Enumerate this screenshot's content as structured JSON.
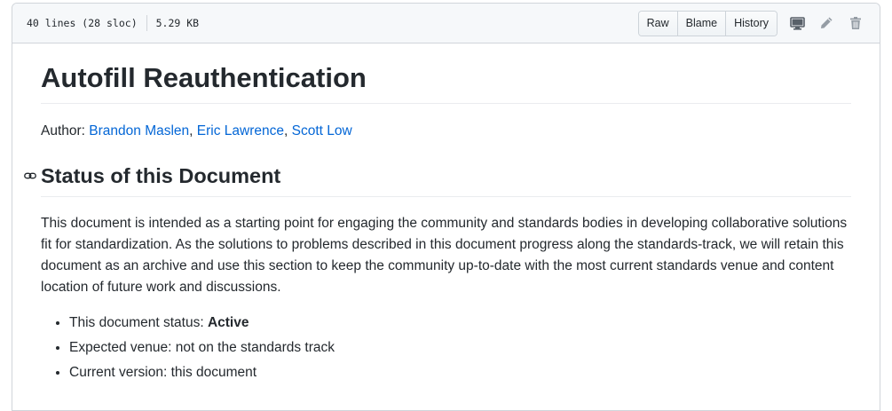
{
  "file_header": {
    "lines": "40 lines (28 sloc)",
    "size": "5.29 KB",
    "buttons": {
      "raw": "Raw",
      "blame": "Blame",
      "history": "History"
    },
    "icons": [
      "desktop-icon",
      "pencil-icon",
      "trash-icon"
    ]
  },
  "document": {
    "title": "Autofill Reauthentication",
    "author_label": "Author: ",
    "authors": [
      "Brandon Maslen",
      "Eric Lawrence",
      "Scott Low"
    ],
    "separator": ", ",
    "status_heading": "Status of this Document",
    "status_paragraph": "This document is intended as a starting point for engaging the community and standards bodies in developing collaborative solutions fit for standardization. As the solutions to problems described in this document progress along the standards-track, we will retain this document as an archive and use this section to keep the community up-to-date with the most current standards venue and content location of future work and discussions.",
    "status_items": [
      {
        "label": "This document status: ",
        "value": "Active"
      },
      {
        "label": "Expected venue: not on the standards track"
      },
      {
        "label": "Current version: this document"
      }
    ]
  },
  "colors": {
    "link": "#0366d6",
    "text": "#24292e",
    "header_bg": "#f6f8fa",
    "border": "#d1d5da",
    "icon": "#959da5"
  }
}
